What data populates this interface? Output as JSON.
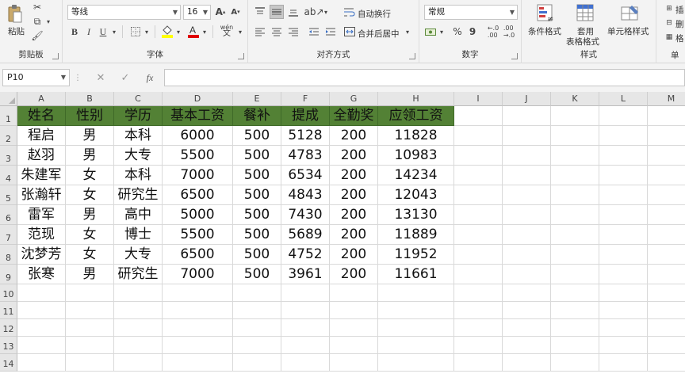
{
  "ribbon": {
    "clipboard": {
      "paste_label": "粘贴",
      "group_label": "剪贴板"
    },
    "font": {
      "font_name": "等线",
      "font_size": "16",
      "bold": "B",
      "italic": "I",
      "underline": "U",
      "phonetic": "wén",
      "group_label": "字体"
    },
    "alignment": {
      "wrap_text": "自动换行",
      "merge_center": "合并后居中",
      "group_label": "对齐方式"
    },
    "number": {
      "format": "常规",
      "percent": "%",
      "comma": "9",
      "group_label": "数字"
    },
    "styles": {
      "conditional": "条件格式",
      "table_line1": "套用",
      "table_line2": "表格格式",
      "cell_styles": "单元格样式",
      "group_label": "样式"
    },
    "cells": {
      "insert": "插",
      "delete": "删",
      "format": "格",
      "group_label": "单"
    }
  },
  "formula_bar": {
    "name_box": "P10",
    "fx": "fx",
    "formula": ""
  },
  "sheet": {
    "columns": [
      "A",
      "B",
      "C",
      "D",
      "E",
      "F",
      "G",
      "H",
      "I",
      "J",
      "K",
      "L",
      "M"
    ],
    "rows": [
      "1",
      "2",
      "3",
      "4",
      "5",
      "6",
      "7",
      "8",
      "9",
      "10",
      "11",
      "12",
      "13",
      "14"
    ],
    "header": [
      "姓名",
      "性别",
      "学历",
      "基本工资",
      "餐补",
      "提成",
      "全勤奖",
      "应领工资"
    ],
    "data": [
      [
        "程启",
        "男",
        "本科",
        "6000",
        "500",
        "5128",
        "200",
        "11828"
      ],
      [
        "赵羽",
        "男",
        "大专",
        "5500",
        "500",
        "4783",
        "200",
        "10983"
      ],
      [
        "朱建军",
        "女",
        "本科",
        "7000",
        "500",
        "6534",
        "200",
        "14234"
      ],
      [
        "张瀚轩",
        "女",
        "研究生",
        "6500",
        "500",
        "4843",
        "200",
        "12043"
      ],
      [
        "雷军",
        "男",
        "高中",
        "5000",
        "500",
        "7430",
        "200",
        "13130"
      ],
      [
        "范现",
        "女",
        "博士",
        "5500",
        "500",
        "5689",
        "200",
        "11889"
      ],
      [
        "沈梦芳",
        "女",
        "大专",
        "6500",
        "500",
        "4752",
        "200",
        "11952"
      ],
      [
        "张寒",
        "男",
        "研究生",
        "7000",
        "500",
        "3961",
        "200",
        "11661"
      ]
    ],
    "header_fill": "#538135"
  }
}
